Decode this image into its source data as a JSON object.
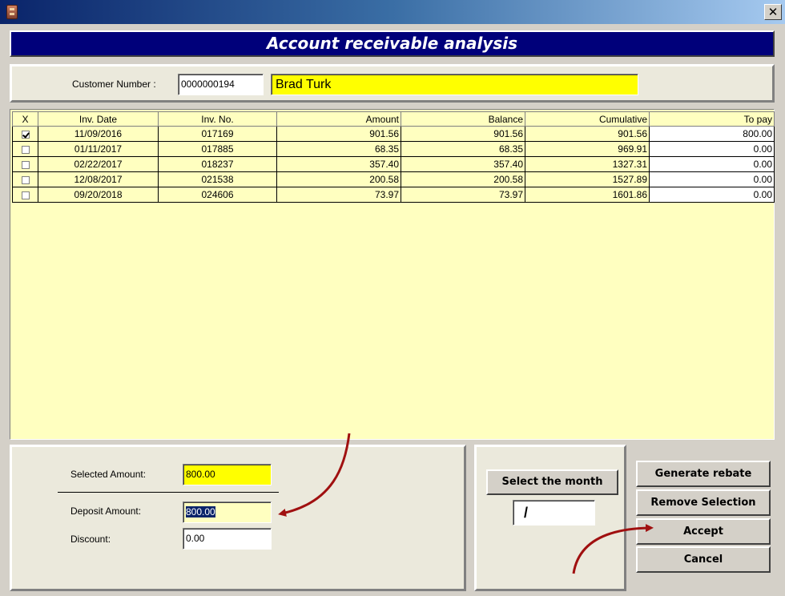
{
  "window": {
    "close_glyph": "✕"
  },
  "header": {
    "title": "Account receivable analysis"
  },
  "customer": {
    "number_label": "Customer Number :",
    "number": "0000000194",
    "name": "Brad Turk"
  },
  "grid": {
    "columns": [
      "X",
      "Inv. Date",
      "Inv. No.",
      "Amount",
      "Balance",
      "Cumulative",
      "To pay"
    ],
    "rows": [
      {
        "checked": true,
        "date": "11/09/2016",
        "inv_no": "017169",
        "amount": "901.56",
        "balance": "901.56",
        "cumulative": "901.56",
        "to_pay": "800.00"
      },
      {
        "checked": false,
        "date": "01/11/2017",
        "inv_no": "017885",
        "amount": "68.35",
        "balance": "68.35",
        "cumulative": "969.91",
        "to_pay": "0.00"
      },
      {
        "checked": false,
        "date": "02/22/2017",
        "inv_no": "018237",
        "amount": "357.40",
        "balance": "357.40",
        "cumulative": "1327.31",
        "to_pay": "0.00"
      },
      {
        "checked": false,
        "date": "12/08/2017",
        "inv_no": "021538",
        "amount": "200.58",
        "balance": "200.58",
        "cumulative": "1527.89",
        "to_pay": "0.00"
      },
      {
        "checked": false,
        "date": "09/20/2018",
        "inv_no": "024606",
        "amount": "73.97",
        "balance": "73.97",
        "cumulative": "1601.86",
        "to_pay": "0.00"
      }
    ]
  },
  "amounts": {
    "selected_label": "Selected Amount:",
    "selected_value": "800.00",
    "deposit_label": "Deposit Amount:",
    "deposit_value": "800.00",
    "discount_label": "Discount:",
    "discount_value": "0.00"
  },
  "month": {
    "button_label": "Select the month",
    "value": "/"
  },
  "actions": {
    "generate_rebate": "Generate rebate",
    "remove_selection": "Remove Selection",
    "accept": "Accept",
    "cancel": "Cancel"
  },
  "colors": {
    "banner": "#00007a",
    "grid_background": "#ffffc0",
    "highlight_yellow": "#ffff00",
    "annotation_arrow": "#a01010"
  }
}
